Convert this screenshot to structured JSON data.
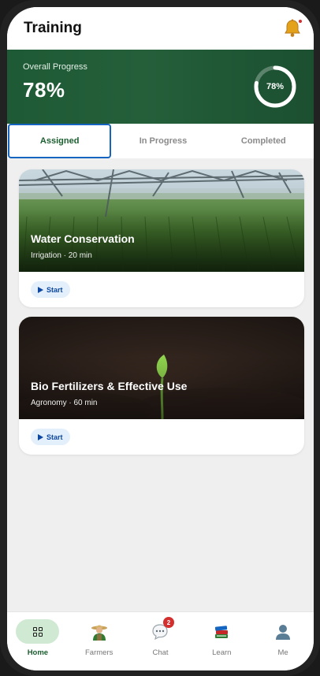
{
  "header": {
    "title": "Training",
    "notification_icon": "bell-icon",
    "has_unread": true
  },
  "progress": {
    "label": "Overall Progress",
    "value_text": "78%",
    "ring_text": "78%",
    "percent": 78
  },
  "tabs": [
    {
      "label": "Assigned",
      "active": true
    },
    {
      "label": "In Progress",
      "active": false
    },
    {
      "label": "Completed",
      "active": false
    }
  ],
  "courses": [
    {
      "title": "Water Conservation",
      "meta": "Irrigation · 20 min",
      "start_label": "Start",
      "image": "irrigation-field-image"
    },
    {
      "title": "Bio Fertilizers & Effective Use",
      "meta": "Agronomy · 60 min",
      "start_label": "Start",
      "image": "seedling-soil-image"
    }
  ],
  "nav": [
    {
      "label": "Home",
      "icon": "home-grid-icon",
      "active": true
    },
    {
      "label": "Farmers",
      "icon": "farmer-icon",
      "active": false
    },
    {
      "label": "Chat",
      "icon": "chat-icon",
      "badge": "2",
      "active": false
    },
    {
      "label": "Learn",
      "icon": "books-icon",
      "active": false
    },
    {
      "label": "Me",
      "icon": "person-icon",
      "active": false
    }
  ],
  "colors": {
    "brand_green": "#1e5a35",
    "accent_blue": "#1565c0",
    "badge_red": "#d32f2f"
  }
}
